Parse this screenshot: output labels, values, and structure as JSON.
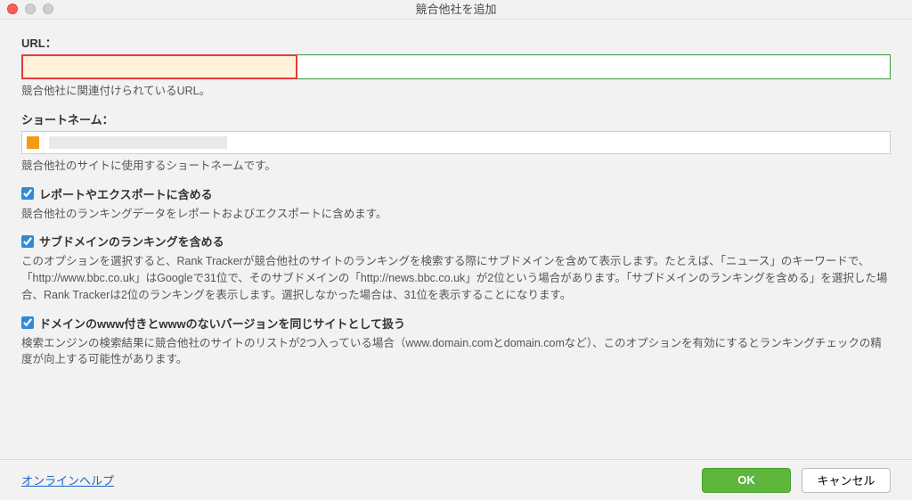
{
  "window": {
    "title": "競合他社を追加"
  },
  "url": {
    "label": "URL：",
    "value": "",
    "help": "競合他社に関連付けられているURL。"
  },
  "shortname": {
    "label": "ショートネーム：",
    "value": "",
    "help": "競合他社のサイトに使用するショートネームです。",
    "swatch_color": "#f39c12"
  },
  "options": {
    "include_in_reports": {
      "checked": true,
      "label": "レポートやエクスポートに含める",
      "help": "競合他社のランキングデータをレポートおよびエクスポートに含めます。"
    },
    "include_subdomains": {
      "checked": true,
      "label": "サブドメインのランキングを含める",
      "help": "このオプションを選択すると、Rank Trackerが競合他社のサイトのランキングを検索する際にサブドメインを含めて表示します。たとえば、「ニュース」のキーワードで、「http://www.bbc.co.uk」はGoogleで31位で、そのサブドメインの「http://news.bbc.co.uk」が2位という場合があります。「サブドメインのランキングを含める」を選択した場合、Rank Trackerは2位のランキングを表示します。選択しなかった場合は、31位を表示することになります。"
    },
    "treat_www_same": {
      "checked": true,
      "label": "ドメインのwww付きとwwwのないバージョンを同じサイトとして扱う",
      "help": "検索エンジンの検索結果に競合他社のサイトのリストが2つ入っている場合（www.domain.comとdomain.comなど）、このオプションを有効にするとランキングチェックの精度が向上する可能性があります。"
    }
  },
  "footer": {
    "help_link": "オンラインヘルプ",
    "ok": "OK",
    "cancel": "キャンセル"
  }
}
